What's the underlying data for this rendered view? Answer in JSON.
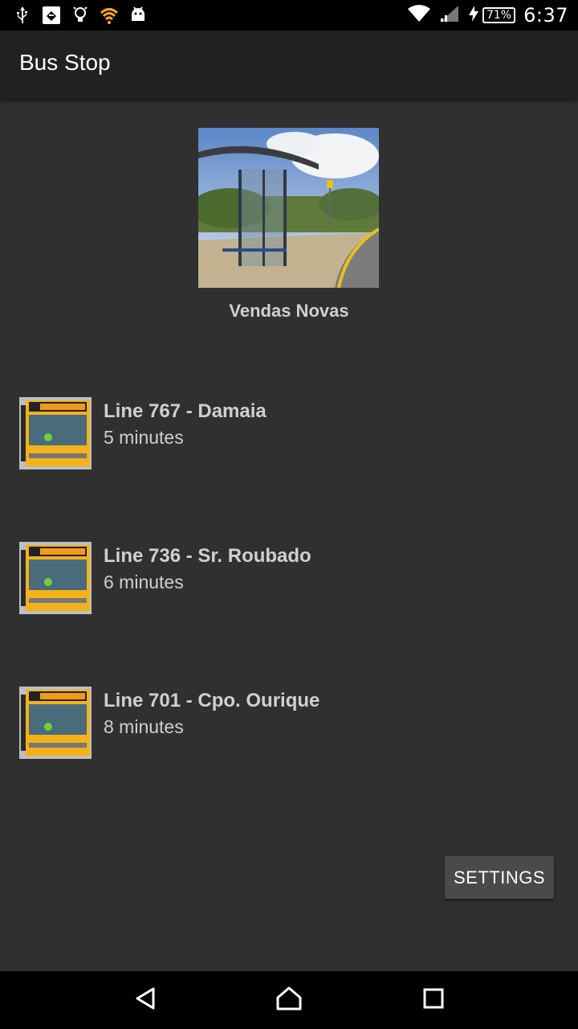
{
  "status_bar": {
    "time": "6:37",
    "battery_percent": "71%",
    "icons": [
      "usb-icon",
      "app-notification-icon",
      "bulb-icon",
      "wifi-notification-icon",
      "android-icon",
      "wifi-icon",
      "signal-icon",
      "charging-icon"
    ]
  },
  "app_bar": {
    "title": "Bus Stop"
  },
  "stop": {
    "name": "Vendas Novas"
  },
  "buses": [
    {
      "title": "Line 767 - Damaia",
      "eta": "5 minutes"
    },
    {
      "title": "Line 736 - Sr. Roubado",
      "eta": "6 minutes"
    },
    {
      "title": "Line 701 - Cpo. Ourique",
      "eta": "8 minutes"
    }
  ],
  "actions": {
    "settings_label": "SETTINGS"
  },
  "nav": {
    "icons": [
      "back-icon",
      "home-icon",
      "recents-icon"
    ]
  },
  "colors": {
    "background": "#303030",
    "app_bar": "#212121",
    "button": "#4a4a4a",
    "bus_yellow": "#f3b21a"
  }
}
